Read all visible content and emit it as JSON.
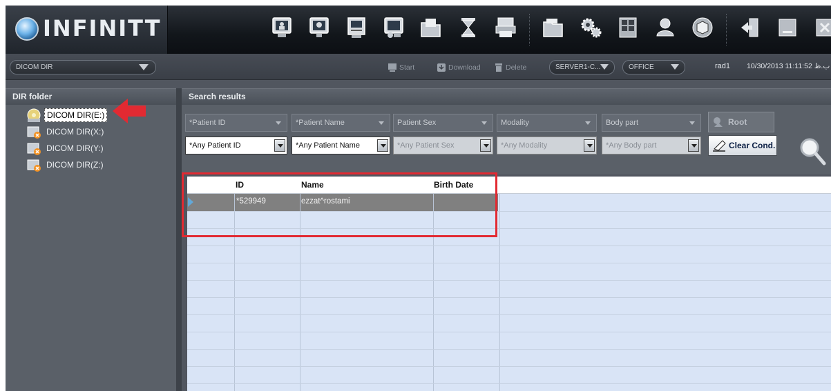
{
  "app": {
    "title": "INFINITT"
  },
  "subbar": {
    "dir_select": "DICOM DIR",
    "start_label": "Start",
    "download_label": "Download",
    "delete_label": "Delete",
    "server_select": "SERVER1-C...",
    "office_select": "OFFICE",
    "user": "rad1",
    "datetime": "10/30/2013 11:11:52 ب.ظ"
  },
  "left": {
    "header": "DIR folder",
    "items": [
      {
        "label": "DICOM DIR(E:)",
        "selected": true
      },
      {
        "label": "DICOM DIR(X:)"
      },
      {
        "label": "DICOM DIR(Y:)"
      },
      {
        "label": "DICOM DIR(Z:)"
      }
    ]
  },
  "right": {
    "header": "Search results",
    "filters_top": [
      "*Patient ID",
      "*Patient Name",
      "Patient Sex",
      "Modality",
      "Body part"
    ],
    "filters_bottom": [
      "*Any Patient ID",
      "*Any Patient Name",
      "*Any Patient Sex",
      "*Any Modality",
      "*Any Body part"
    ],
    "root_label": "Root",
    "clear_label": "Clear Cond."
  },
  "grid": {
    "columns": [
      "ID",
      "Name",
      "Birth Date"
    ],
    "rows": [
      {
        "id": "*529949",
        "name": "ezzat^rostami",
        "birth_date": ""
      }
    ]
  },
  "colors": {
    "accent_red": "#e22a32",
    "selected_row": "#808080",
    "grid_bg": "#d9e4f6"
  }
}
